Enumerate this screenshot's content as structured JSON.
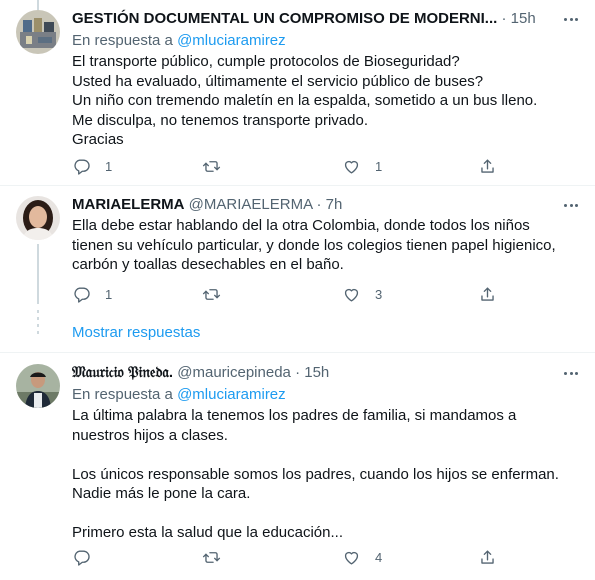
{
  "tweets": [
    {
      "name": "GESTIÓN DOCUMENTAL UN COMPROMISO DE MODERNI...",
      "handle": "",
      "time": "15h",
      "reply_prefix": "En respuesta a ",
      "reply_to": "@mluciaramirez",
      "lines": [
        "El transporte público, cumple protocolos de Bioseguridad?",
        "Usted ha evaluado, últimamente el servicio público de buses?",
        "Un niño con tremendo maletín en la espalda, sometido a un bus lleno.",
        "Me disculpa, no tenemos transporte privado.",
        "Gracias"
      ],
      "replies": "1",
      "retweets": "",
      "likes": "1"
    },
    {
      "name": "MARIAELERMA",
      "handle": "@MARIAELERMA",
      "time": "7h",
      "lines": [
        "Ella debe estar hablando del la otra Colombia, donde todos los niños",
        "tienen su vehículo particular, y donde los colegios tienen papel higienico,",
        "carbón y toallas desechables en el baño."
      ],
      "replies": "1",
      "retweets": "",
      "likes": "3"
    },
    {
      "name": "𝔐𝔞𝔲𝔯𝔦𝔠𝔦𝔬 𝔓𝔦𝔫𝔢𝔡𝔞.",
      "handle": "@mauricepineda",
      "time": "15h",
      "reply_prefix": "En respuesta a ",
      "reply_to": "@mluciaramirez",
      "lines": [
        "La última palabra la tenemos los padres de familia, si mandamos a",
        "nuestros hijos a clases.",
        "",
        "Los únicos responsable somos los padres, cuando los hijos se enferman.",
        "Nadie más le pone la cara.",
        "",
        "Primero esta la salud que la educación..."
      ],
      "replies": "",
      "retweets": "",
      "likes": "4"
    }
  ],
  "show_replies_label": "Mostrar respuestas",
  "separator_dot": "·",
  "icons": [
    "reply-icon",
    "retweet-icon",
    "like-icon",
    "share-icon",
    "more-icon"
  ],
  "colors": {
    "link": "#1d9bf0",
    "secondary": "#536471",
    "text": "#0f1419",
    "thread": "#cfd9de"
  }
}
